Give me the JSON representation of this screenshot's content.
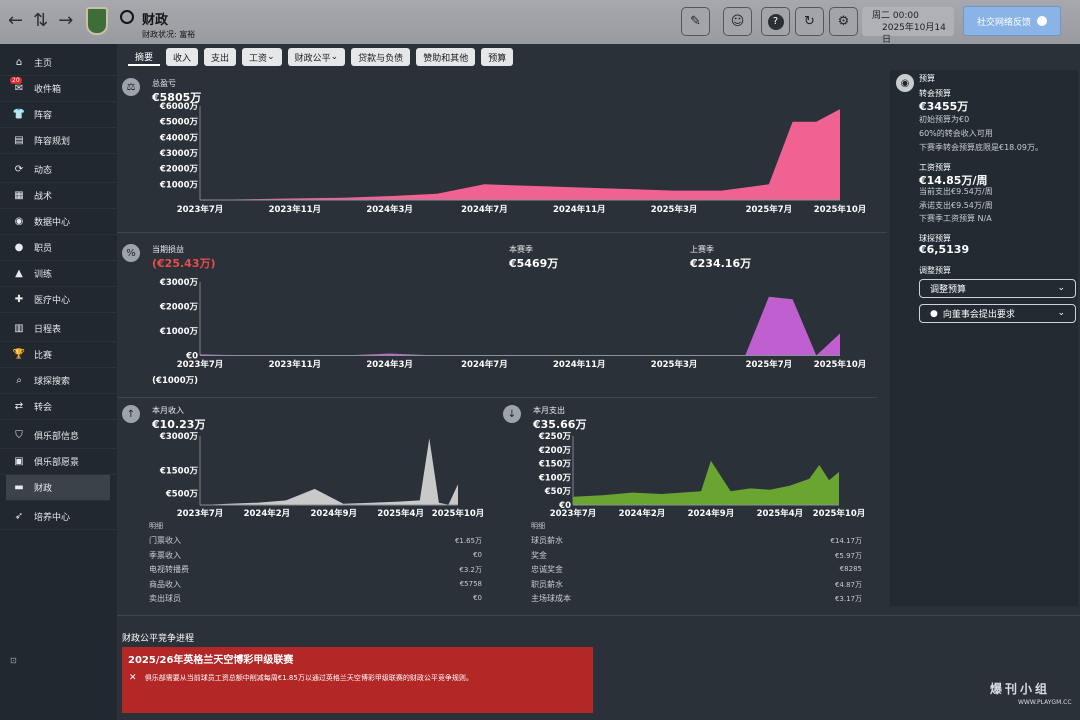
{
  "topbar": {
    "title": "财政",
    "subtitle": "财政状况: 富裕",
    "date_line1": "周二 00:00",
    "date_line2": "2025年10月14日",
    "social_button": "社交网络反馈"
  },
  "sidebar": {
    "items": [
      {
        "label": "主页",
        "icon": "home-icon"
      },
      {
        "label": "收件箱",
        "icon": "inbox-icon",
        "badge": "20"
      },
      {
        "label": "阵容",
        "icon": "shirt-icon"
      },
      {
        "label": "阵容规划",
        "icon": "clipboard-icon"
      },
      {
        "label": "动态",
        "icon": "dynamics-icon"
      },
      {
        "label": "战术",
        "icon": "tactics-icon"
      },
      {
        "label": "数据中心",
        "icon": "data-icon"
      },
      {
        "label": "职员",
        "icon": "staff-icon"
      },
      {
        "label": "训练",
        "icon": "training-icon"
      },
      {
        "label": "医疗中心",
        "icon": "medical-icon"
      },
      {
        "label": "日程表",
        "icon": "calendar-icon"
      },
      {
        "label": "比赛",
        "icon": "trophy-icon"
      },
      {
        "label": "球探搜索",
        "icon": "search-icon"
      },
      {
        "label": "转会",
        "icon": "transfer-icon"
      },
      {
        "label": "俱乐部信息",
        "icon": "shield-icon"
      },
      {
        "label": "俱乐部愿景",
        "icon": "briefcase-icon"
      },
      {
        "label": "财政",
        "icon": "wallet-icon",
        "active": true
      },
      {
        "label": "培养中心",
        "icon": "development-icon"
      }
    ]
  },
  "tabs": [
    "摘要",
    "收入",
    "支出",
    "工资",
    "财政公平",
    "贷款与负债",
    "赞助和其他",
    "预算"
  ],
  "balance": {
    "label": "总盈亏",
    "value": "€5805万",
    "y_ticks": [
      "€6000万",
      "€5000万",
      "€4000万",
      "€3000万",
      "€2000万",
      "€1000万"
    ],
    "x_ticks": [
      "2023年7月",
      "2023年11月",
      "2024年3月",
      "2024年7月",
      "2024年11月",
      "2025年3月",
      "2025年7月",
      "2025年10月"
    ]
  },
  "profit": {
    "current_label": "当期损益",
    "current_value": "(€25.43万)",
    "this_season_label": "本赛季",
    "this_season_value": "€5469万",
    "last_season_label": "上赛季",
    "last_season_value": "€234.16万",
    "y_ticks": [
      "€3000万",
      "€2000万",
      "€1000万",
      "€0",
      "(€1000万)"
    ],
    "x_ticks": [
      "2023年7月",
      "2023年11月",
      "2024年3月",
      "2024年7月",
      "2024年11月",
      "2025年3月",
      "2025年7月",
      "2025年10月"
    ]
  },
  "income": {
    "label": "本月收入",
    "value": "€10.23万",
    "y_ticks": [
      "€3000万",
      "€1500万",
      "€500万"
    ],
    "x_ticks": [
      "2023年7月",
      "2024年2月",
      "2024年9月",
      "2025年4月",
      "2025年10月"
    ],
    "detail_header": "明细",
    "rows": [
      {
        "name": "门票收入",
        "value": "€1.65万"
      },
      {
        "name": "季票收入",
        "value": "€0"
      },
      {
        "name": "电视转播费",
        "value": "€3.2万"
      },
      {
        "name": "商品收入",
        "value": "€5758"
      },
      {
        "name": "卖出球员",
        "value": "€0"
      }
    ]
  },
  "expense": {
    "label": "本月支出",
    "value": "€35.66万",
    "y_ticks": [
      "€250万",
      "€200万",
      "€150万",
      "€100万",
      "€50万",
      "€0"
    ],
    "x_ticks": [
      "2023年7月",
      "2024年2月",
      "2024年9月",
      "2025年4月",
      "2025年10月"
    ],
    "detail_header": "明细",
    "rows": [
      {
        "name": "球员薪水",
        "value": "€14.17万"
      },
      {
        "name": "奖金",
        "value": "€5.97万"
      },
      {
        "name": "忠诚奖金",
        "value": "€8285"
      },
      {
        "name": "职员薪水",
        "value": "€4.87万"
      },
      {
        "name": "主场球成本",
        "value": "€3.17万"
      }
    ]
  },
  "budget": {
    "header": "预算",
    "transfer_label": "转会预算",
    "transfer_value": "€3455万",
    "transfer_note1": "初始预算为€0",
    "transfer_note2": "60%的转会收入可用",
    "transfer_note3": "下赛季转会预算底限是€18.09万。",
    "wage_label": "工资预算",
    "wage_value": "€14.85万/周",
    "wage_note1": "当前支出€9.54万/周",
    "wage_note2": "承诺支出€9.54万/周",
    "wage_note3": "下赛季工资预算 N/A",
    "scout_label": "球探预算",
    "scout_value": "€6,5139",
    "adjust_label": "调整预算",
    "adjust_dropdown": "调整预算",
    "board_dropdown": "向董事会提出要求"
  },
  "ffp": {
    "title": "财政公平竞争进程",
    "league": "2025/26年英格兰天空博彩甲级联赛",
    "message": "俱乐部需要从当前球员工资总额中削减每周€1.85万以通过英格兰天空博彩甲级联赛的财政公平竞争规则。"
  },
  "watermark": "爆刊小组",
  "watermark_url": "WWW.PLAYGM.CC",
  "chart_data": [
    {
      "type": "area",
      "title": "总盈亏",
      "x": [
        "2023-07",
        "2023-09",
        "2023-11",
        "2024-01",
        "2024-03",
        "2024-05",
        "2024-07",
        "2024-09",
        "2024-11",
        "2025-01",
        "2025-03",
        "2025-05",
        "2025-07",
        "2025-08",
        "2025-09",
        "2025-10"
      ],
      "values": [
        0,
        50,
        100,
        150,
        250,
        400,
        1000,
        900,
        800,
        700,
        600,
        600,
        1000,
        5000,
        5000,
        5805
      ],
      "ylim": [
        0,
        6000
      ],
      "unit": "万",
      "color": "#f06292"
    },
    {
      "type": "area",
      "title": "当期损益",
      "x": [
        "2023-07",
        "2023-09",
        "2023-11",
        "2024-01",
        "2024-03",
        "2024-05",
        "2024-07",
        "2024-09",
        "2024-11",
        "2025-01",
        "2025-03",
        "2025-05",
        "2025-06",
        "2025-07",
        "2025-08",
        "2025-09",
        "2025-10"
      ],
      "values": [
        50,
        0,
        0,
        0,
        80,
        0,
        0,
        0,
        0,
        0,
        0,
        0,
        0,
        2400,
        2300,
        0,
        900
      ],
      "ylim": [
        -1000,
        3000
      ],
      "unit": "万",
      "color": "#c060d0"
    },
    {
      "type": "area",
      "title": "本月收入",
      "x": [
        "2023-07",
        "2023-10",
        "2024-01",
        "2024-04",
        "2024-07",
        "2024-10",
        "2025-01",
        "2025-04",
        "2025-06",
        "2025-07",
        "2025-08",
        "2025-09",
        "2025-10"
      ],
      "values": [
        0,
        50,
        100,
        200,
        700,
        50,
        100,
        150,
        200,
        2900,
        100,
        10,
        900
      ],
      "ylim": [
        0,
        3000
      ],
      "unit": "万",
      "color": "#c9c9c9"
    },
    {
      "type": "area",
      "title": "本月支出",
      "x": [
        "2023-07",
        "2023-10",
        "2024-01",
        "2024-04",
        "2024-06",
        "2024-08",
        "2024-09",
        "2024-11",
        "2025-01",
        "2025-03",
        "2025-05",
        "2025-07",
        "2025-08",
        "2025-09",
        "2025-10"
      ],
      "values": [
        30,
        35,
        45,
        40,
        45,
        50,
        160,
        50,
        60,
        55,
        70,
        95,
        145,
        90,
        120
      ],
      "ylim": [
        0,
        250
      ],
      "unit": "万",
      "color": "#6aa531"
    }
  ]
}
